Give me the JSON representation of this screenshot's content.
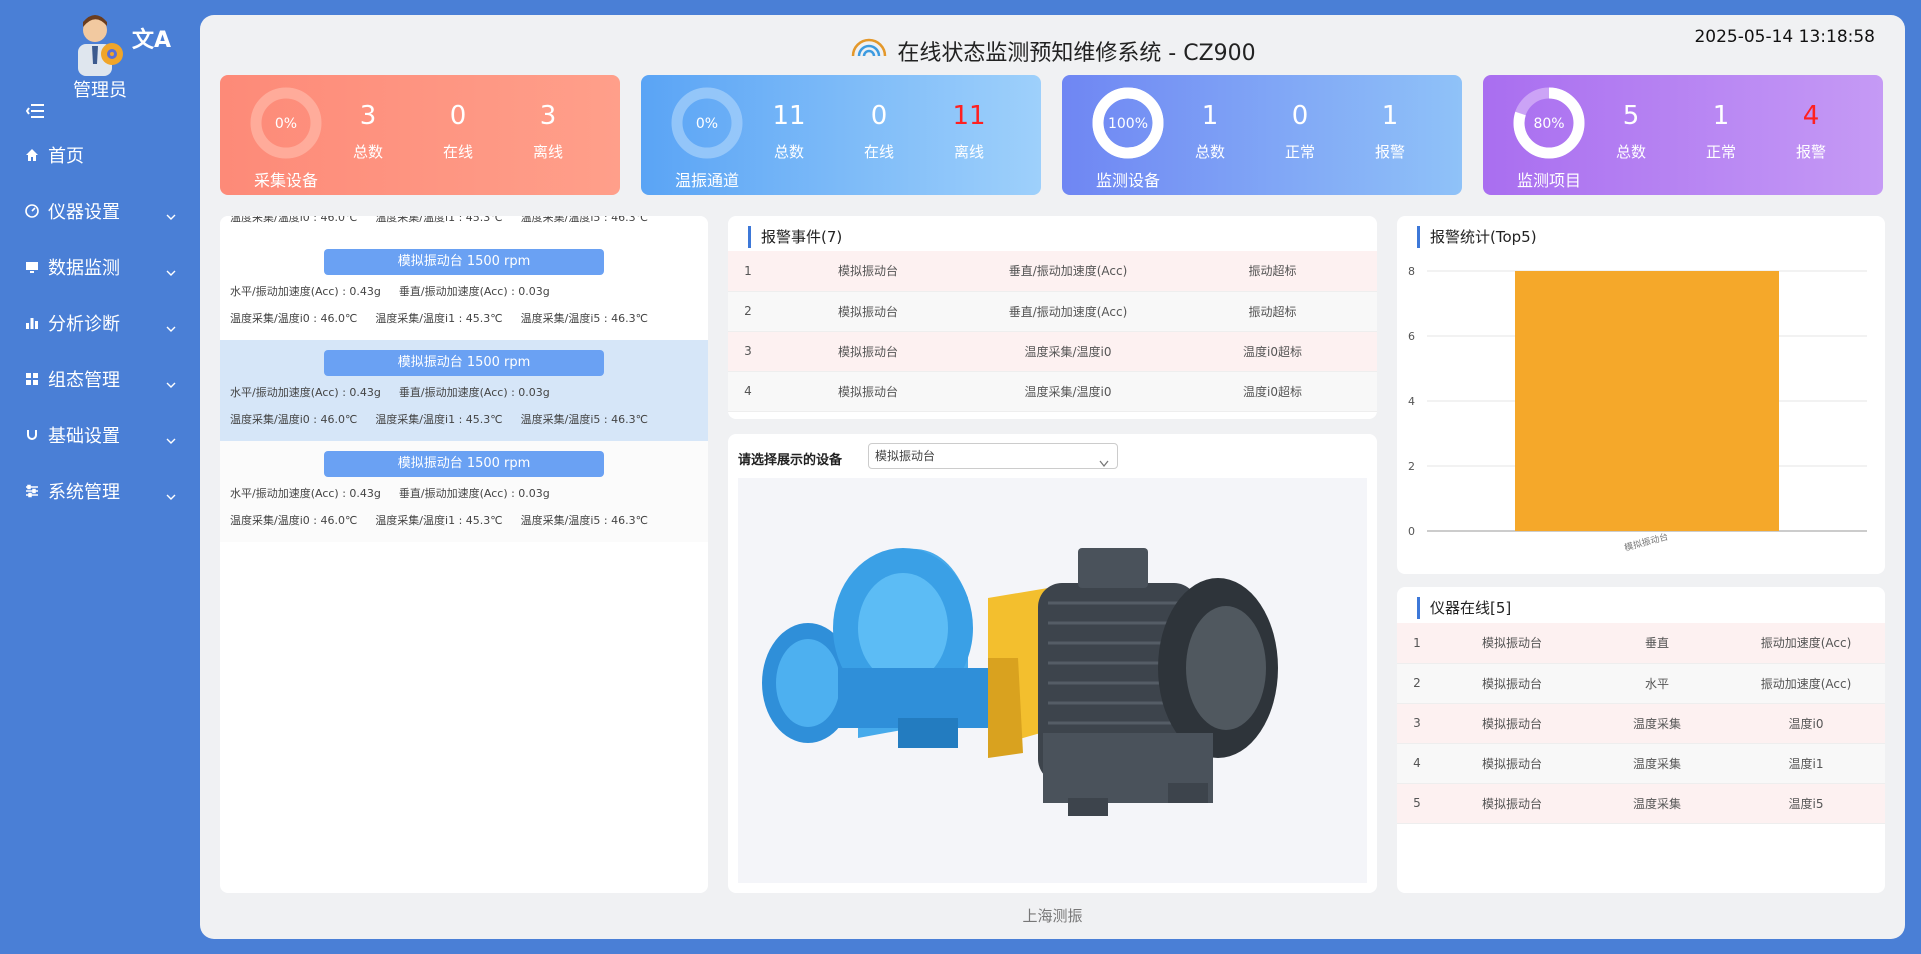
{
  "app_title": "在线状态监测预知维修系统 - CZ900",
  "datetime": "2025-05-14 13:18:58",
  "sidebar": {
    "user": "管理员",
    "translate_icon": "文A",
    "items": [
      {
        "label": "首页",
        "icon": "home-icon",
        "expandable": false
      },
      {
        "label": "仪器设置",
        "icon": "gauge-icon",
        "expandable": true
      },
      {
        "label": "数据监测",
        "icon": "monitor-icon",
        "expandable": true
      },
      {
        "label": "分析诊断",
        "icon": "bar-chart-icon",
        "expandable": true
      },
      {
        "label": "组态管理",
        "icon": "grid-icon",
        "expandable": true
      },
      {
        "label": "基础设置",
        "icon": "magnet-icon",
        "expandable": true
      },
      {
        "label": "系统管理",
        "icon": "sliders-icon",
        "expandable": true
      }
    ]
  },
  "cards": [
    {
      "ring_text": "0%",
      "ring_label": "采集设备",
      "ring_percent": 0,
      "stats": [
        {
          "num": "3",
          "label": "总数"
        },
        {
          "num": "0",
          "label": "在线"
        },
        {
          "num": "3",
          "label": "离线"
        }
      ],
      "bg_from": "#fd8a78",
      "bg_to": "#ff9f8a",
      "track": "#ffb8a8",
      "fill": "#ffffff",
      "accent_index": -1
    },
    {
      "ring_text": "0%",
      "ring_label": "温振通道",
      "ring_percent": 0,
      "stats": [
        {
          "num": "11",
          "label": "总数"
        },
        {
          "num": "0",
          "label": "在线"
        },
        {
          "num": "11",
          "label": "离线"
        }
      ],
      "bg_from": "#5aa4f5",
      "bg_to": "#9ed0fb",
      "track": "#a8d2fb",
      "fill": "#ffffff",
      "accent_index": 2
    },
    {
      "ring_text": "100%",
      "ring_label": "监测设备",
      "ring_percent": 100,
      "stats": [
        {
          "num": "1",
          "label": "总数"
        },
        {
          "num": "0",
          "label": "正常"
        },
        {
          "num": "1",
          "label": "报警"
        }
      ],
      "bg_from": "#6f86f3",
      "bg_to": "#8fc2f8",
      "track": "#ffffff",
      "fill": "#ffffff",
      "accent_index": -1
    },
    {
      "ring_text": "80%",
      "ring_label": "监测项目",
      "ring_percent": 80,
      "stats": [
        {
          "num": "5",
          "label": "总数"
        },
        {
          "num": "1",
          "label": "正常"
        },
        {
          "num": "4",
          "label": "报警"
        }
      ],
      "bg_from": "#a96ef0",
      "bg_to": "#c59af5",
      "track": "#d8b8f8",
      "fill": "#ffffff",
      "accent_index": 2
    }
  ],
  "devices": {
    "items": [
      {
        "title": "模拟振动台 1500 rpm",
        "l1": [
          "水平/振动加速度(Acc) : 0.43g",
          "垂直/振动加速度(Acc) : 0.03g"
        ],
        "l2": [
          "温度采集/温度i0 : 46.0℃",
          "温度采集/温度i1 : 45.3℃",
          "温度采集/温度i5 : 46.3℃"
        ]
      },
      {
        "title": "模拟振动台 1500 rpm",
        "l1": [
          "水平/振动加速度(Acc) : 0.43g",
          "垂直/振动加速度(Acc) : 0.03g"
        ],
        "l2": [
          "温度采集/温度i0 : 46.0℃",
          "温度采集/温度i1 : 45.3℃",
          "温度采集/温度i5 : 46.3℃"
        ]
      },
      {
        "title": "模拟振动台 1500 rpm",
        "l1": [
          "水平/振动加速度(Acc) : 0.43g",
          "垂直/振动加速度(Acc) : 0.03g"
        ],
        "l2": [
          "温度采集/温度i0 : 46.0℃",
          "温度采集/温度i1 : 45.3℃",
          "温度采集/温度i5 : 46.3℃"
        ]
      },
      {
        "title": "模拟振动台 1500 rpm",
        "l1": [
          "水平/振动加速度(Acc) : 0.43g",
          "垂直/振动加速度(Acc) : 0.03g"
        ],
        "l2": [
          "温度采集/温度i0 : 46.0℃",
          "温度采集/温度i1 : 45.3℃",
          "温度采集/温度i5 : 46.3℃"
        ]
      }
    ]
  },
  "alarm_events": {
    "title": "报警事件(7)",
    "rows": [
      [
        "1",
        "模拟振动台",
        "垂直/振动加速度(Acc)",
        "振动超标"
      ],
      [
        "2",
        "模拟振动台",
        "垂直/振动加速度(Acc)",
        "振动超标"
      ],
      [
        "3",
        "模拟振动台",
        "温度采集/温度i0",
        "温度i0超标"
      ],
      [
        "4",
        "模拟振动台",
        "温度采集/温度i0",
        "温度i0超标"
      ]
    ]
  },
  "device_view": {
    "select_label": "请选择展示的设备",
    "selected": "模拟振动台"
  },
  "alarm_stats": {
    "title": "报警统计(Top5)"
  },
  "chart_data": {
    "type": "bar",
    "title": "报警统计(Top5)",
    "categories": [
      "模拟振动台"
    ],
    "values": [
      8
    ],
    "ylim": [
      0,
      8
    ],
    "yticks": [
      "0",
      "2",
      "4",
      "6",
      "8"
    ],
    "grid": true,
    "bar_color": "#f5a82a"
  },
  "instruments": {
    "title": "仪器在线[5]",
    "rows": [
      [
        "1",
        "模拟振动台",
        "垂直",
        "振动加速度(Acc)"
      ],
      [
        "2",
        "模拟振动台",
        "水平",
        "振动加速度(Acc)"
      ],
      [
        "3",
        "模拟振动台",
        "温度采集",
        "温度i0"
      ],
      [
        "4",
        "模拟振动台",
        "温度采集",
        "温度i1"
      ],
      [
        "5",
        "模拟振动台",
        "温度采集",
        "温度i5"
      ]
    ]
  },
  "footer": "上海测振",
  "colors": {
    "alert_red": "#ff2020",
    "accent": "#3d78d8"
  }
}
